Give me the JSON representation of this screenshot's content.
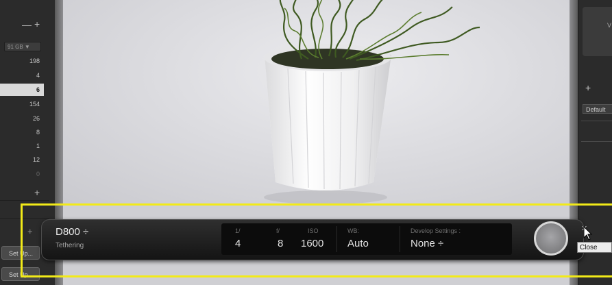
{
  "left_panel": {
    "minus": "—",
    "plus": "+",
    "storage": "91 GB ▼",
    "counts": [
      "198",
      "4",
      "6",
      "154",
      "26",
      "8",
      "1",
      "12",
      "0"
    ],
    "selected_index": 2,
    "plus_bottom": "+",
    "plus_lower": "+",
    "setup_button": "Set Up...",
    "setup_button2": "Set Up..."
  },
  "right_panel": {
    "top_text": "V",
    "plus": "+",
    "preset": "Default"
  },
  "tether_bar": {
    "camera": "D800 ÷",
    "status": "Tethering",
    "shutter_label": "1/",
    "shutter_value": "4",
    "aperture_label": "f/",
    "aperture_value": "8",
    "iso_label": "ISO",
    "iso_value": "1600",
    "wb_label": "WB:",
    "wb_value": "Auto",
    "develop_label": "Develop Settings :",
    "develop_value": "None ÷",
    "close_icon": "✕"
  },
  "tooltip": {
    "text": "Close"
  },
  "colors": {
    "highlight": "#f2ea18",
    "bar_bg": "#1c1c1c",
    "panel": "#2b2b2b"
  }
}
